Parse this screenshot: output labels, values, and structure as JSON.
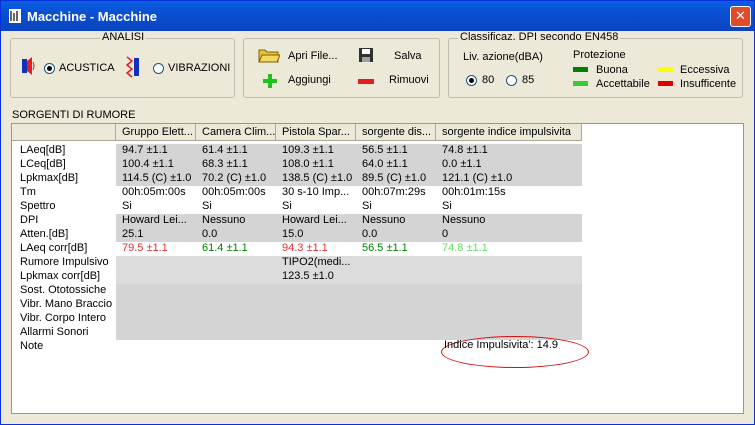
{
  "window": {
    "title": "Macchine - Macchine"
  },
  "analisi": {
    "title": "ANALISI",
    "acustica_label": "ACUSTICA",
    "vibrazioni_label": "VIBRAZIONI",
    "selected": "ACUSTICA"
  },
  "toolbar": {
    "open_label": "Apri File...",
    "save_label": "Salva",
    "add_label": "Aggiungi",
    "remove_label": "Rimuovi"
  },
  "dpi": {
    "title": "Classificaz. DPI secondo EN458",
    "liv_azione_label": "Liv. azione(dBA)",
    "option_80": "80",
    "option_85": "85",
    "selected": "80",
    "protezione_label": "Protezione",
    "legend": [
      {
        "label": "Buona",
        "color": "#008000"
      },
      {
        "label": "Accettabile",
        "color": "#33cc33"
      },
      {
        "label": "Eccessiva",
        "color": "#ffff00"
      },
      {
        "label": "Insufficente",
        "color": "#e00000"
      }
    ]
  },
  "sorgenti": {
    "title": "SORGENTI DI RUMORE",
    "columns": [
      "Gruppo Elett...",
      "Camera Clim...",
      "Pistola Spar...",
      "sorgente dis...",
      "sorgente indice impulsivita"
    ],
    "row_labels": [
      "LAeq[dB]",
      "LCeq[dB]",
      "Lpkmax[dB]",
      "Tm",
      "Spettro",
      "DPI",
      "Atten.[dB]",
      "LAeq corr[dB]",
      "Rumore Impulsivo",
      "Lpkmax corr[dB]",
      "Sost. Ototossiche",
      "Vibr. Mano Braccio",
      "Vibr. Corpo Intero",
      "Allarmi Sonori",
      "Note"
    ],
    "rows": [
      [
        "94.7 ±1.1",
        "61.4 ±1.1",
        "109.3 ±1.1",
        "56.5 ±1.1",
        "74.8 ±1.1"
      ],
      [
        "100.4 ±1.1",
        "68.3 ±1.1",
        "108.0 ±1.1",
        "64.0 ±1.1",
        "0.0 ±1.1"
      ],
      [
        "114.5 (C) ±1.0",
        "70.2 (C) ±1.0",
        "138.5 (C) ±1.0",
        "89.5 (C) ±1.0",
        "121.1 (C) ±1.0"
      ],
      [
        "00h:05m:00s",
        "00h:05m:00s",
        "30 s-10 Imp...",
        "00h:07m:29s",
        "00h:01m:15s"
      ],
      [
        "Si",
        "Si",
        "Si",
        "Si",
        "Si"
      ],
      [
        "Howard Lei...",
        "Nessuno",
        "Howard Lei...",
        "Nessuno",
        "Nessuno"
      ],
      [
        "25.1",
        "0.0",
        "15.0",
        "0.0",
        "0"
      ],
      [
        "79.5 ±1.1",
        "61.4 ±1.1",
        "94.3 ±1.1",
        "56.5 ±1.1",
        "74.8 ±1.1"
      ],
      [
        "",
        "",
        "TIPO2(medi...",
        "",
        ""
      ],
      [
        "",
        "",
        "123.5 ±1.0",
        "",
        ""
      ],
      [
        "",
        "",
        "",
        "",
        ""
      ],
      [
        "",
        "",
        "",
        "",
        ""
      ],
      [
        "",
        "",
        "",
        "",
        ""
      ],
      [
        "",
        "",
        "",
        "",
        ""
      ],
      [
        "",
        "",
        "",
        "",
        "Indice Impulsivita': 14.9"
      ]
    ],
    "corr_colors": [
      "#e03030",
      "#008000",
      "#e03030",
      "#008000",
      "#66dd66"
    ]
  }
}
